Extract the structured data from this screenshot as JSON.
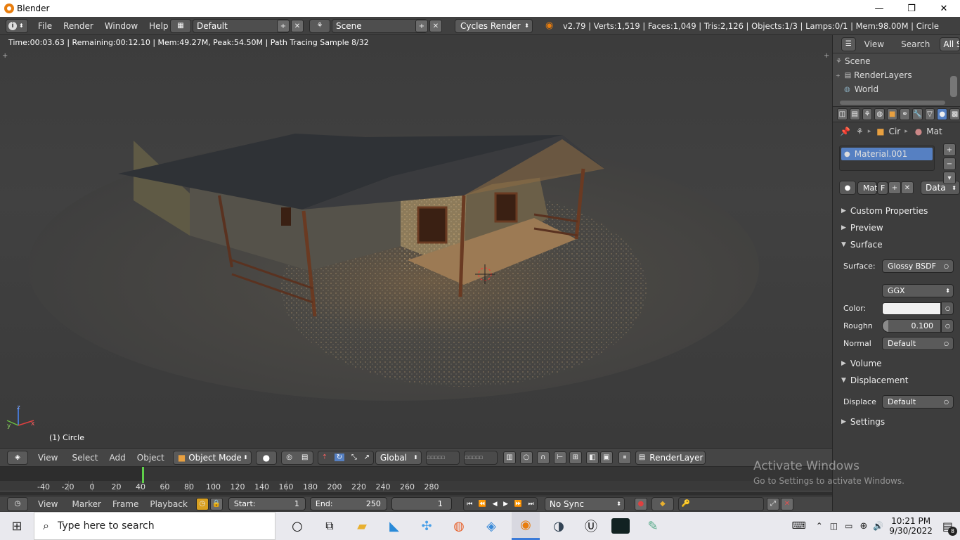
{
  "window": {
    "title": "Blender",
    "minimize": "—",
    "maximize": "❐",
    "close": "✕"
  },
  "info": {
    "menus": [
      "File",
      "Render",
      "Window",
      "Help"
    ],
    "screen_layout": "Default",
    "scene": "Scene",
    "engine": "Cycles Render",
    "stats": "v2.79 | Verts:1,519 | Faces:1,049 | Tris:2,126 | Objects:1/3 | Lamps:0/1 | Mem:98.00M | Circle"
  },
  "viewport": {
    "render_status": "Time:00:03.63 | Remaining:00:12.10 | Mem:49.27M, Peak:54.50M | Path Tracing Sample 8/32",
    "object_label": "(1) Circle"
  },
  "view3d_header": {
    "menus": [
      "View",
      "Select",
      "Add",
      "Object"
    ],
    "mode": "Object Mode",
    "orientation": "Global",
    "render_layer": "RenderLayer"
  },
  "timeline": {
    "ticks": [
      "-40",
      "-20",
      "0",
      "20",
      "40",
      "60",
      "80",
      "100",
      "120",
      "140",
      "160",
      "180",
      "200",
      "220",
      "240",
      "260",
      "280"
    ],
    "menus": [
      "View",
      "Marker",
      "Frame",
      "Playback"
    ],
    "start_label": "Start:",
    "start_value": "1",
    "end_label": "End:",
    "end_value": "250",
    "current_frame": "1",
    "sync": "No Sync"
  },
  "outliner": {
    "menus": [
      "View",
      "Search",
      "All Sc"
    ],
    "items": [
      "Scene",
      "RenderLayers",
      "World"
    ]
  },
  "properties": {
    "breadcrumb": [
      "Cir",
      "Mat"
    ],
    "material_slot": "Material.001",
    "material_name": "Mat",
    "fake_user": "F",
    "link": "Data",
    "sections": {
      "custom": "Custom Properties",
      "preview": "Preview",
      "surface": "Surface",
      "volume": "Volume",
      "displacement": "Displacement",
      "settings": "Settings"
    },
    "surface_label": "Surface:",
    "surface_value": "Glossy BSDF",
    "distribution": "GGX",
    "color_label": "Color:",
    "roughness_label": "Roughn",
    "roughness_value": "0.100",
    "normal_label": "Normal",
    "normal_value": "Default",
    "displace_label": "Displace",
    "displace_value": "Default"
  },
  "watermark": {
    "title": "Activate Windows",
    "subtitle": "Go to Settings to activate Windows."
  },
  "taskbar": {
    "search_placeholder": "Type here to search",
    "time": "10:21 PM",
    "date": "9/30/2022",
    "notifications": "8"
  },
  "colors": {
    "accent": "#5680c2",
    "blender_orange": "#e87d0d",
    "viewport_bg": "#3d3d3d"
  }
}
